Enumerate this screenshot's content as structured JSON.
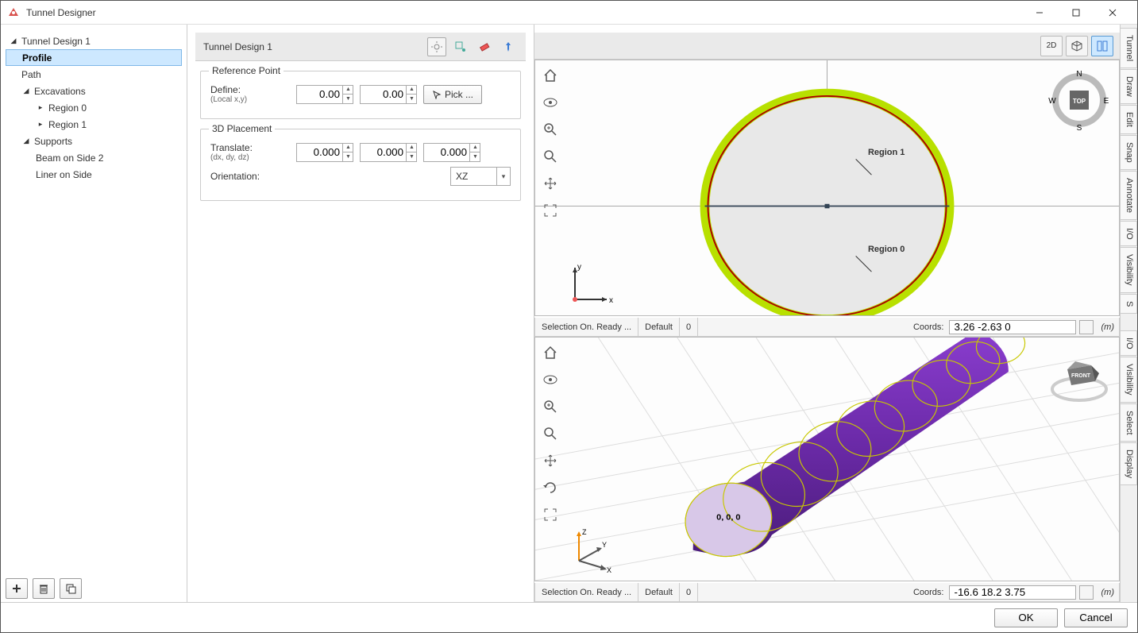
{
  "window": {
    "title": "Tunnel Designer"
  },
  "tree": {
    "root": "Tunnel Design 1",
    "items": [
      {
        "label": "Profile",
        "selected": true
      },
      {
        "label": "Path"
      },
      {
        "label": "Excavations",
        "expandable": true,
        "children": [
          {
            "label": "Region 0"
          },
          {
            "label": "Region 1"
          }
        ]
      },
      {
        "label": "Supports",
        "expandable": true,
        "children": [
          {
            "label": "Beam on Side 2"
          },
          {
            "label": "Liner on Side"
          }
        ]
      }
    ]
  },
  "mid": {
    "title": "Tunnel Design 1",
    "refpoint": {
      "legend": "Reference Point",
      "define_label": "Define:",
      "define_sub": "(Local x,y)",
      "x": "0.00",
      "y": "0.00",
      "pick": "Pick ..."
    },
    "placement": {
      "legend": "3D Placement",
      "translate_label": "Translate:",
      "translate_sub": "(dx, dy, dz)",
      "dx": "0.000",
      "dy": "0.000",
      "dz": "0.000",
      "orientation_label": "Orientation:",
      "orientation_value": "XZ"
    }
  },
  "topview": {
    "region1": "Region 1",
    "region0": "Region 0",
    "status": "Selection On. Ready ...",
    "default": "Default",
    "zero": "0",
    "coords_label": "Coords:",
    "coords": "3.26 -2.63 0",
    "unit": "(m)",
    "compass": {
      "n": "N",
      "e": "E",
      "s": "S",
      "w": "W",
      "top": "TOP"
    },
    "axes": {
      "x": "x",
      "y": "y"
    }
  },
  "bottomview": {
    "origin": "0, 0, 0",
    "status": "Selection On. Ready ...",
    "default": "Default",
    "zero": "0",
    "coords_label": "Coords:",
    "coords": "-16.6 18.2 3.75",
    "unit": "(m)",
    "cube": "FRONT",
    "axes": {
      "x": "X",
      "y": "Y",
      "z": "Z"
    }
  },
  "sidetabs": {
    "top": [
      "Tunnel",
      "Draw",
      "Edit",
      "Snap",
      "Annotate",
      "I/O",
      "Visibility",
      "S"
    ],
    "bottom": [
      "I/O",
      "Visibility",
      "Select",
      "Display"
    ]
  },
  "topbar": {
    "v2d": "2D"
  },
  "buttons": {
    "ok": "OK",
    "cancel": "Cancel"
  }
}
